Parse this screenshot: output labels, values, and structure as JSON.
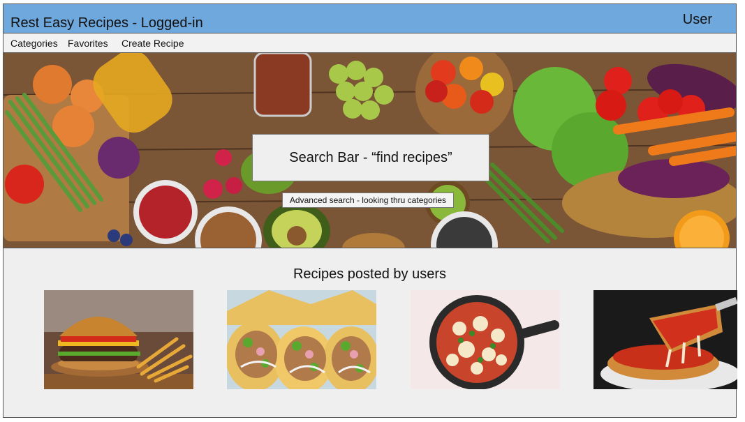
{
  "header": {
    "title": "Rest Easy Recipes - Logged-in",
    "user_label": "User",
    "bar_color": "#6fa8dc"
  },
  "nav": {
    "items": [
      {
        "label": "Categories"
      },
      {
        "label": "Favorites"
      },
      {
        "label": "Create Recipe"
      }
    ]
  },
  "hero": {
    "search_label": "Search Bar - “find recipes”",
    "advanced_search_label": "Advanced search - looking thru categories"
  },
  "recipes": {
    "heading": "Recipes posted by users",
    "cards": [
      {
        "image": "burger-and-fries-image"
      },
      {
        "image": "tacos-image"
      },
      {
        "image": "skillet-pizza-image"
      },
      {
        "image": "deep-dish-pizza-image"
      }
    ]
  }
}
